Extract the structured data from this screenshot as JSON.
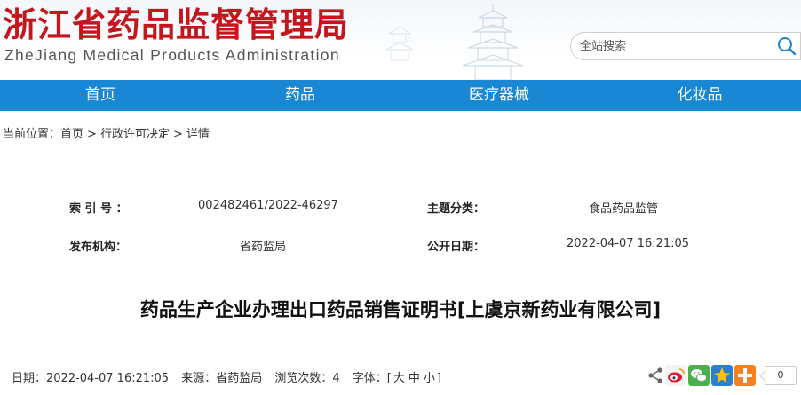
{
  "header": {
    "title": "浙江省药品监督管理局",
    "subtitle": "ZheJiang Medical Products Administration"
  },
  "search": {
    "placeholder": "全站搜索"
  },
  "nav": {
    "items": [
      {
        "label": "首页"
      },
      {
        "label": "药品"
      },
      {
        "label": "医疗器械"
      },
      {
        "label": "化妆品"
      }
    ]
  },
  "breadcrumb": {
    "prefix": "当前位置：",
    "items": [
      "首页",
      "行政许可决定",
      "详情"
    ],
    "separator": ">"
  },
  "meta": {
    "index_label": "索 引 号 ：",
    "index_value": "002482461/2022-46297",
    "topic_label": "主题分类：",
    "topic_value": "食品药品监管",
    "publisher_label": "发布机构：",
    "publisher_value": "省药监局",
    "date_label": "公开日期：",
    "date_value": "2022-04-07 16:21:05"
  },
  "article": {
    "title": "药品生产企业办理出口药品销售证明书[上虞京新药业有限公司]"
  },
  "footer": {
    "date": "日期：2022-04-07 16:21:05",
    "source": "来源：省药监局",
    "views": "浏览次数：4",
    "font_label": "字体：[",
    "font_large": "大",
    "font_medium": "中",
    "font_small": "小",
    "font_close": "]"
  },
  "share": {
    "count": "0",
    "icons": [
      "share-icon",
      "weibo-icon",
      "wechat-icon",
      "qzone-icon",
      "more-plus-icon"
    ]
  },
  "colors": {
    "brand_red": "#c4161c",
    "nav_blue": "#1a87d4"
  }
}
